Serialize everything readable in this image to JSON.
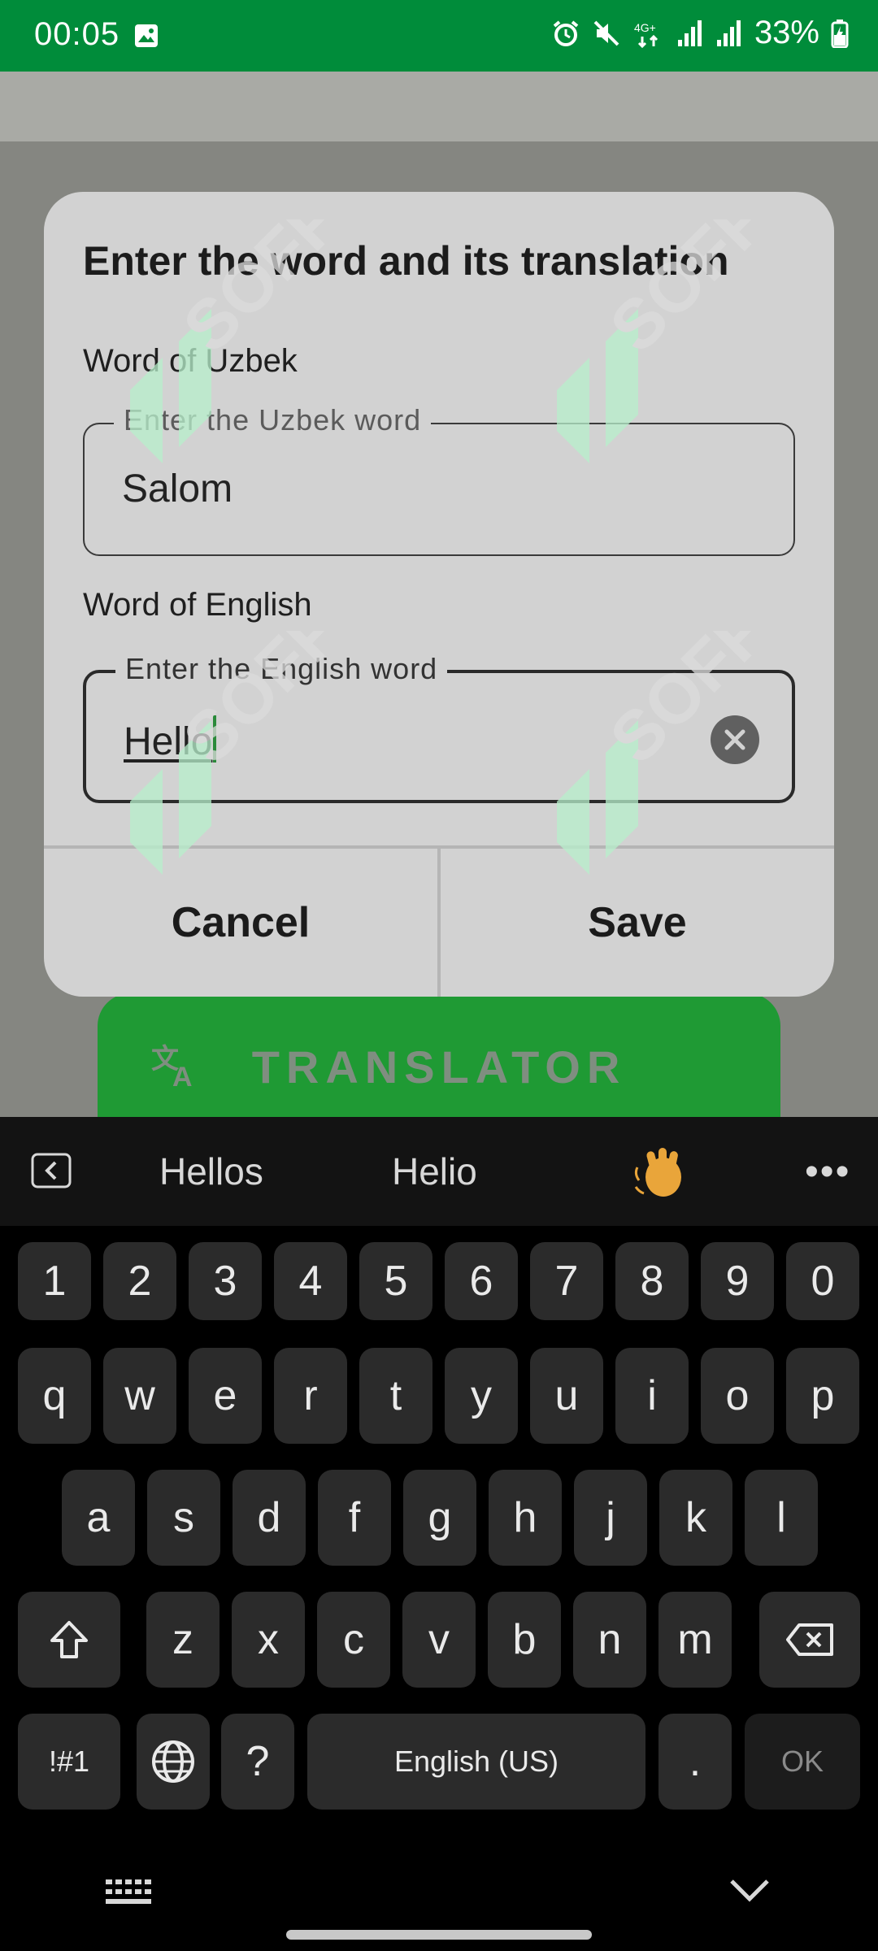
{
  "status_bar": {
    "time": "00:05",
    "battery": "33%",
    "network": "4G+",
    "icons": [
      "image-icon",
      "alarm-icon",
      "mute-icon",
      "network-4g-icon",
      "signal-icon",
      "signal-icon",
      "battery-charging-icon"
    ]
  },
  "background_app": {
    "translator_label": "TRANSLATOR",
    "translate_icon": "translate-icon"
  },
  "dialog": {
    "title": "Enter the word and its translation",
    "uzbek": {
      "label": "Word of Uzbek",
      "placeholder": "Enter the Uzbek word",
      "value": "Salom"
    },
    "english": {
      "label": "Word of English",
      "placeholder": "Enter the English word",
      "value": "Hello"
    },
    "cancel_label": "Cancel",
    "save_label": "Save"
  },
  "watermark": {
    "text": "SOFF"
  },
  "keyboard": {
    "suggestions": [
      "Hellos",
      "Helio"
    ],
    "emoji_suggestion": "waving-hand-icon",
    "row_numbers": [
      "1",
      "2",
      "3",
      "4",
      "5",
      "6",
      "7",
      "8",
      "9",
      "0"
    ],
    "row_top": [
      "q",
      "w",
      "e",
      "r",
      "t",
      "y",
      "u",
      "i",
      "o",
      "p"
    ],
    "row_middle": [
      "a",
      "s",
      "d",
      "f",
      "g",
      "h",
      "j",
      "k",
      "l"
    ],
    "row_bottom": [
      "z",
      "x",
      "c",
      "v",
      "b",
      "n",
      "m"
    ],
    "symbols_label": "!#1",
    "question_label": "?",
    "space_label": "English (US)",
    "period_label": ".",
    "ok_label": "OK"
  },
  "colors": {
    "status_bar": "#008c3a",
    "translator_button": "#1f9a34",
    "dialog_bg": "#d2d2d2",
    "keyboard_bg": "#000000",
    "key_bg": "#2b2b2b",
    "caret": "#2a8a3a"
  }
}
